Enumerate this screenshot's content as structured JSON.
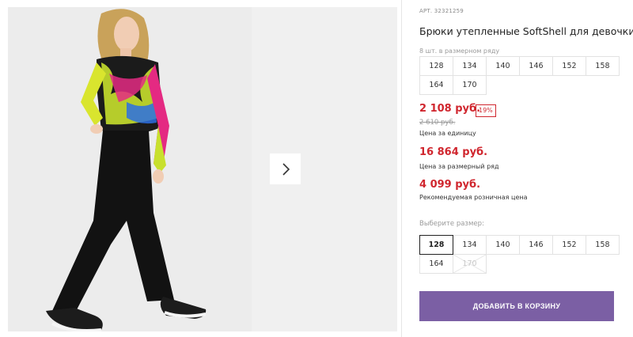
{
  "gallery": {
    "next_icon": "chevron-right-icon"
  },
  "product": {
    "article": "АРТ. 32321259",
    "title": "Брюки утепленные SoftShell для девочки",
    "pack_note": "8 шт. в размерном ряду",
    "pack_sizes": [
      "128",
      "134",
      "140",
      "146",
      "152",
      "158",
      "164",
      "170"
    ]
  },
  "pricing": {
    "unit_price": "2 108 руб.",
    "discount": "19%",
    "old_price": "2 610 руб.",
    "unit_caption": "Цена за единицу",
    "pack_price": "16 864 руб.",
    "pack_caption": "Цена за размерный ряд",
    "retail_price": "4 099 руб.",
    "retail_caption": "Рекомендуемая розничная цена"
  },
  "size_selector": {
    "label": "Выберите размер:",
    "selected": "128",
    "options": [
      {
        "label": "128",
        "state": "selected"
      },
      {
        "label": "134",
        "state": "available"
      },
      {
        "label": "140",
        "state": "available"
      },
      {
        "label": "146",
        "state": "available"
      },
      {
        "label": "152",
        "state": "available"
      },
      {
        "label": "158",
        "state": "available"
      },
      {
        "label": "164",
        "state": "available"
      },
      {
        "label": "170",
        "state": "disabled"
      }
    ]
  },
  "cart": {
    "add_label": "ДОБАВИТЬ В КОРЗИНУ"
  },
  "colors": {
    "accent": "#7b5fa4",
    "price_red": "#d0262e"
  }
}
